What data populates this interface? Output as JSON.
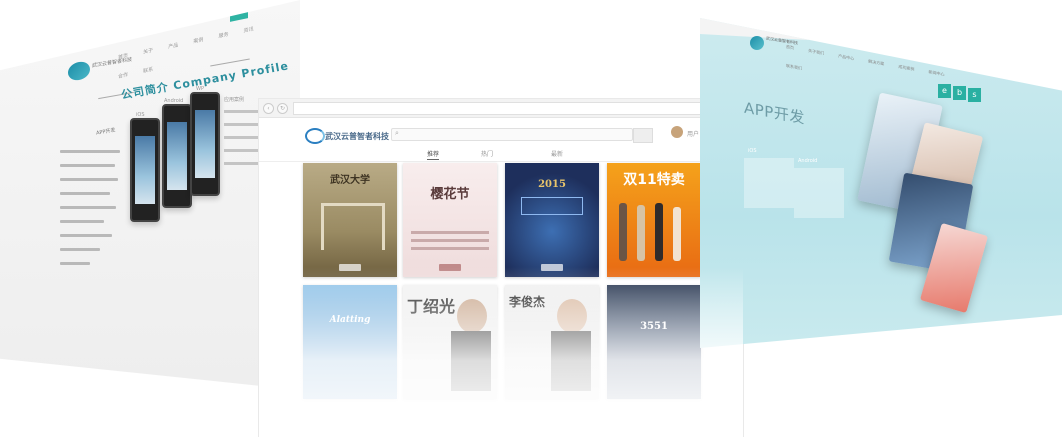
{
  "left_panel": {
    "logo_text": "武汉云普智者科技",
    "nav_items": [
      "首页",
      "关于",
      "产品",
      "案例",
      "服务",
      "资讯",
      "合作",
      "联系"
    ],
    "heading": "公司简介 Company Profile",
    "sidebar_label": "APP开发",
    "phone_labels": [
      "iOS",
      "Android",
      "WP"
    ],
    "right_label": "应用案例"
  },
  "center_panel": {
    "logo_text": "武汉云普智者科技",
    "search_placeholder": "",
    "user_name": "用户",
    "tabs": [
      "推荐",
      "热门",
      "最新"
    ],
    "add_icon": "+",
    "cards": [
      {
        "caption": "武汉大学",
        "theme": "campus-gate"
      },
      {
        "caption": "樱花节",
        "theme": "cherry-blossom"
      },
      {
        "caption": "2015",
        "theme": "tech-blue"
      },
      {
        "caption": "双11特卖",
        "theme": "shopping-orange"
      },
      {
        "caption": "Alatting",
        "theme": "blue-dome"
      },
      {
        "caption": "丁绍光",
        "theme": "portrait-dark"
      },
      {
        "caption": "李俊杰",
        "theme": "portrait-dark"
      },
      {
        "caption": "3551",
        "theme": "city-night"
      }
    ]
  },
  "right_panel": {
    "logo_text": "武汉云普智者科技",
    "nav_items": [
      "首页",
      "关于我们",
      "产品中心",
      "解决方案",
      "成功案例",
      "新闻中心",
      "联系我们"
    ],
    "title": "APP开发",
    "icon_buttons": [
      "e",
      "b",
      "s"
    ],
    "box_labels": [
      "iOS",
      "Android"
    ]
  }
}
